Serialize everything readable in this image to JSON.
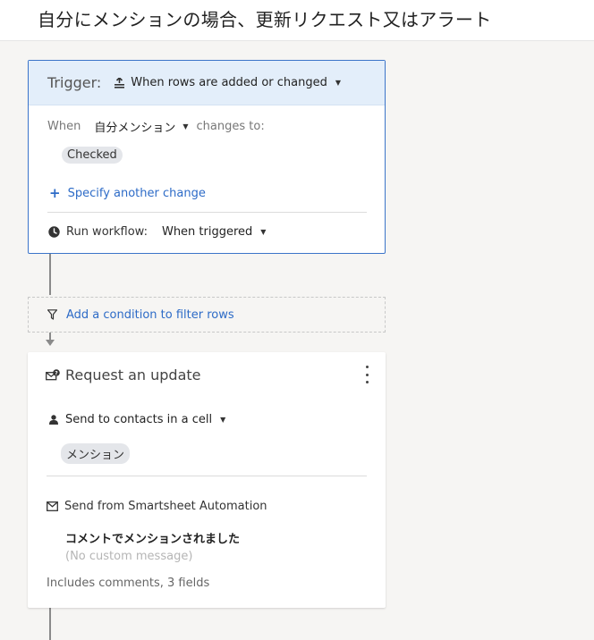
{
  "page": {
    "title": "自分にメンションの場合、更新リクエスト又はアラート"
  },
  "trigger": {
    "label": "Trigger:",
    "event_option": "When rows are added or changed",
    "when_label": "When",
    "column": "自分メンション",
    "changes_to_label": "changes to:",
    "value_chip": "Checked",
    "specify_link": "Specify another change",
    "run_label": "Run workflow:",
    "run_option": "When triggered"
  },
  "filter": {
    "label": "Add a condition to filter rows"
  },
  "action": {
    "title": "Request an update",
    "recipients_option": "Send to contacts in a cell",
    "recipient_chip": "メンション",
    "sender": "Send from Smartsheet Automation",
    "subject": "コメントでメンションされました",
    "message_placeholder": "(No custom message)",
    "includes": "Includes comments, 3 fields"
  },
  "icons": {
    "trigger_event": "rows-change-icon",
    "run": "clock-icon",
    "filter": "funnel-icon",
    "action": "request-update-icon",
    "recipients": "person-icon",
    "sender": "envelope-icon",
    "menu": "more-vertical-icon"
  },
  "colors": {
    "accent": "#3b74c9",
    "link": "#2d6bc7",
    "trigger_header_bg": "#e3eefa",
    "chip_bg": "#e4e6ea",
    "page_bg": "#f6f5f3"
  }
}
